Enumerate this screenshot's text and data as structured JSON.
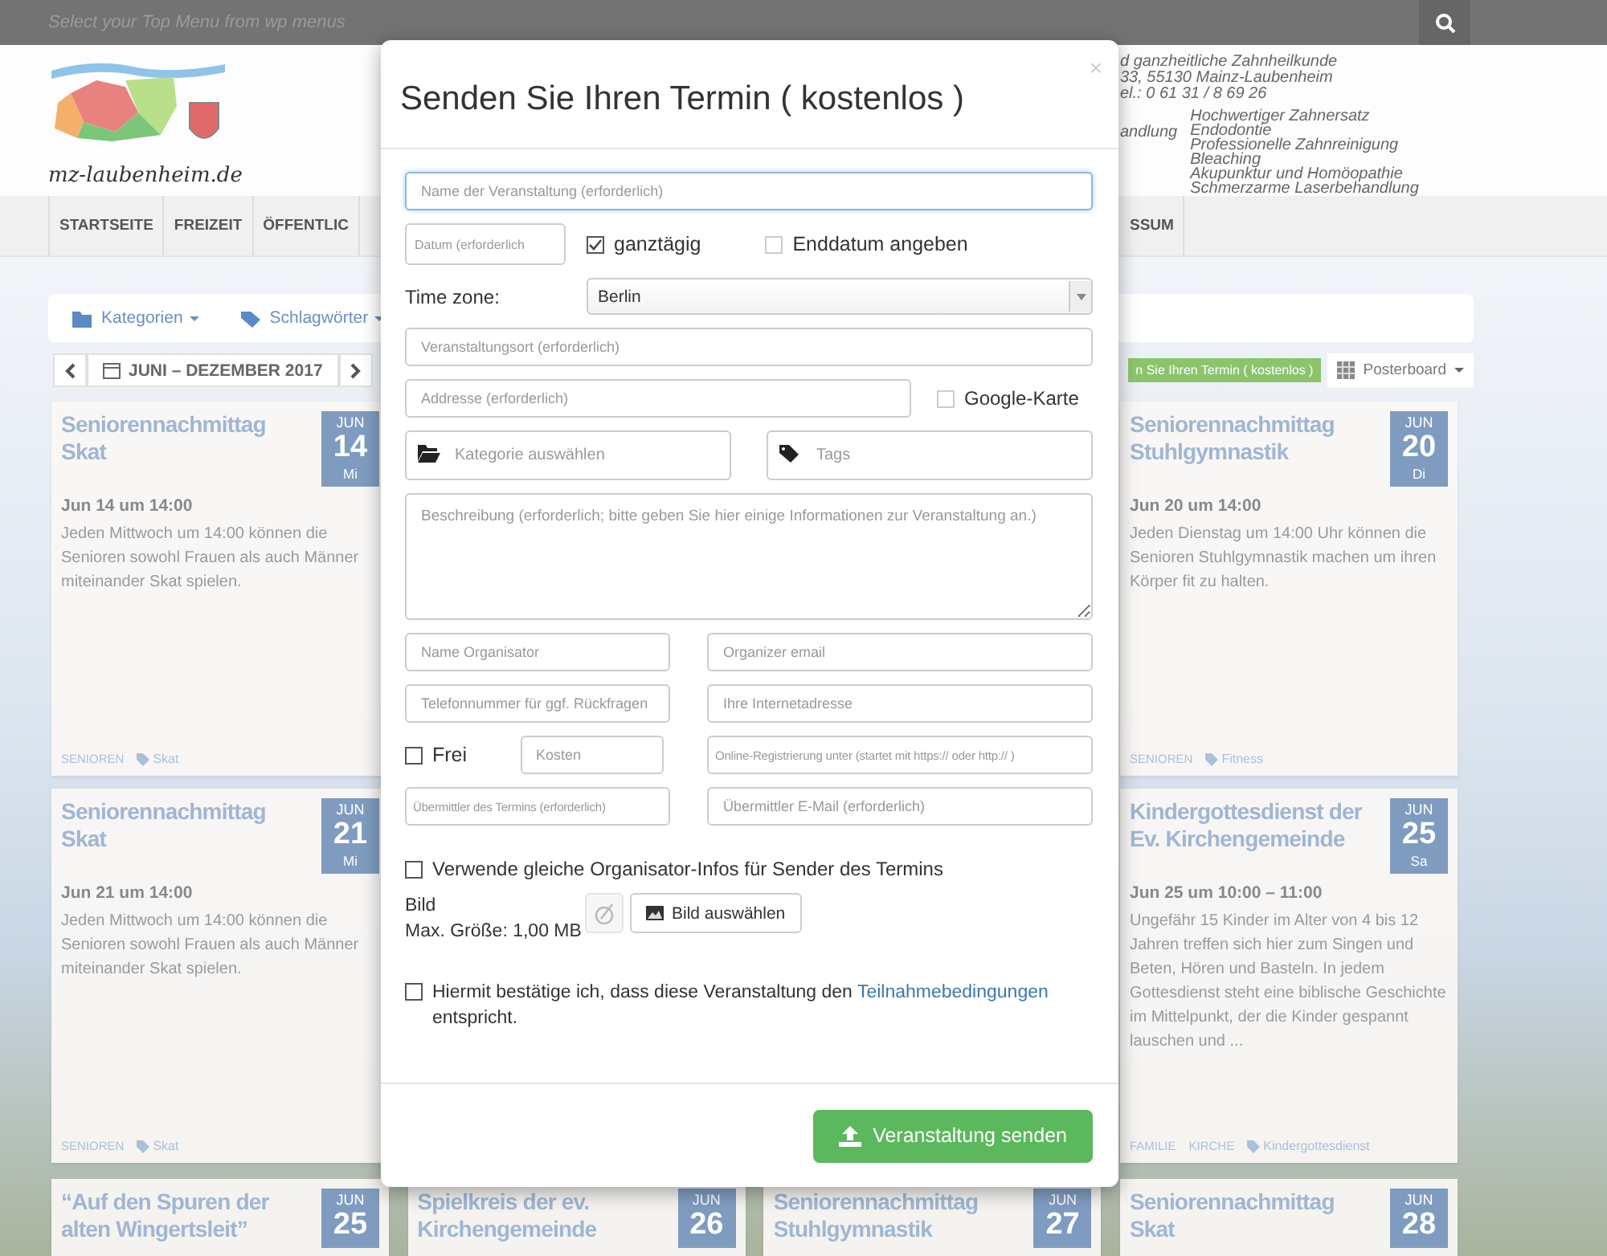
{
  "top_bar": {
    "menu_hint": "Select your Top Menu from wp menus"
  },
  "site_header": {
    "logo_text": "mz-laubenheim.de",
    "ad_lines": [
      "d ganzheitliche Zahnheilkunde",
      "33, 55130 Mainz-Laubenheim",
      "el.: 0 61 31 / 8 69 26"
    ],
    "ad_label": "andlung",
    "ad_services": [
      "Hochwertiger Zahnersatz",
      "Endodontie",
      "Professionelle Zahnreinigung",
      "Bleaching",
      "Akupunktur und Homöopathie",
      "Schmerzarme Laserbehandlung"
    ]
  },
  "nav": {
    "items": [
      "STARTSEITE",
      "FREIZEIT",
      "ÖFFENTLIC"
    ],
    "items_right": [
      "SSUM"
    ]
  },
  "filter_bar": {
    "categories": "Kategorien",
    "tags": "Schlagwörter"
  },
  "date_nav": {
    "range": "JUNI – DEZEMBER 2017"
  },
  "submit_button_partial": "n Sie Ihren Termin ( kostenlos )",
  "view_button": "Posterboard",
  "cards_left": [
    {
      "title": "Seniorennachmittag Skat",
      "month": "JUN",
      "day": "14",
      "weekday": "Mi",
      "when": "Jun 14 um 14:00",
      "text": "Jeden Mittwoch um 14:00 können die Senioren sowohl Frauen als auch Männer miteinander Skat spielen.",
      "categories": [
        "SENIOREN"
      ],
      "tag": "Skat"
    },
    {
      "title": "Seniorennachmittag Skat",
      "month": "JUN",
      "day": "21",
      "weekday": "Mi",
      "when": "Jun 21 um 14:00",
      "text": "Jeden Mittwoch um 14:00 können die Senioren sowohl Frauen als auch Männer miteinander Skat spielen.",
      "categories": [
        "SENIOREN"
      ],
      "tag": "Skat"
    }
  ],
  "cards_right": [
    {
      "title": "Seniorennachmittag Stuhlgymnastik",
      "month": "JUN",
      "day": "20",
      "weekday": "Di",
      "when": "Jun 20 um 14:00",
      "text": "Jeden Dienstag um 14:00 Uhr können die Senioren Stuhlgymnastik machen um ihren Körper fit zu halten.",
      "categories": [
        "SENIOREN"
      ],
      "tag": "Fitness"
    },
    {
      "title": "Kindergottesdienst der Ev. Kirchengemeinde",
      "month": "JUN",
      "day": "25",
      "weekday": "Sa",
      "when": "Jun 25 um 10:00 – 11:00",
      "text": "Ungefähr 15 Kinder im Alter von 4 bis 12 Jahren treffen sich hier zum Singen und Beten, Hören und Basteln. In jedem Gottesdienst steht eine biblische Geschichte im Mittelpunkt, der die Kinder gespannt lauschen und ...",
      "categories": [
        "FAMILIE",
        "KIRCHE"
      ],
      "tag": "Kindergottesdienst"
    }
  ],
  "cards_bottom": [
    {
      "title": "“Auf den Spuren der alten Wingertsleit”",
      "month": "JUN",
      "day": "25"
    },
    {
      "title": "Spielkreis der ev. Kirchengemeinde",
      "month": "JUN",
      "day": "26"
    },
    {
      "title": "Seniorennachmittag Stuhlgymnastik",
      "month": "JUN",
      "day": "27"
    },
    {
      "title": "Seniorennachmittag Skat",
      "month": "JUN",
      "day": "28"
    }
  ],
  "modal": {
    "title": "Senden Sie Ihren Termin ( kostenlos )",
    "close": "×",
    "name_placeholder": "Name der Veranstaltung (erforderlich)",
    "date_placeholder": "Datum (erforderlich",
    "all_day": {
      "label": "ganztägig",
      "checked": true
    },
    "end_date": {
      "label": "Enddatum angeben",
      "checked": false
    },
    "timezone_label": "Time zone:",
    "timezone_value": "Berlin",
    "venue_placeholder": "Veranstaltungsort (erforderlich)",
    "address_placeholder": "Addresse (erforderlich)",
    "google_map": {
      "label": "Google-Karte",
      "checked": false
    },
    "category_placeholder": "Kategorie auswählen",
    "tags_placeholder": "Tags",
    "description_placeholder": "Beschreibung (erforderlich; bitte geben Sie hier einige Informationen zur Veranstaltung an.)",
    "organizer_name_placeholder": "Name Organisator",
    "organizer_email_placeholder": "Organizer email",
    "phone_placeholder": "Telefonnummer für ggf. Rückfragen",
    "website_placeholder": "Ihre Internetadresse",
    "free": {
      "label": "Frei",
      "checked": false
    },
    "cost_placeholder": "Kosten",
    "registration_placeholder": "Online-Registrierung unter (startet mit https:// oder http:// )",
    "submitter_name_placeholder": "Übermittler des Termins (erforderlich)",
    "submitter_email_placeholder": "Übermittler E-Mail (erforderlich)",
    "same_info": {
      "label": "Verwende gleiche Organisator-Infos für Sender des Termins",
      "checked": false
    },
    "image_label": "Bild",
    "image_size": "Max. Größe: 1,00 MB",
    "image_button": "Bild auswählen",
    "terms": {
      "checked": false,
      "text_before": "Hiermit bestätige ich, dass diese Veranstaltung den",
      "link": "Teilnahmebedingungen",
      "text_after": "entspricht."
    },
    "submit": "Veranstaltung senden"
  }
}
